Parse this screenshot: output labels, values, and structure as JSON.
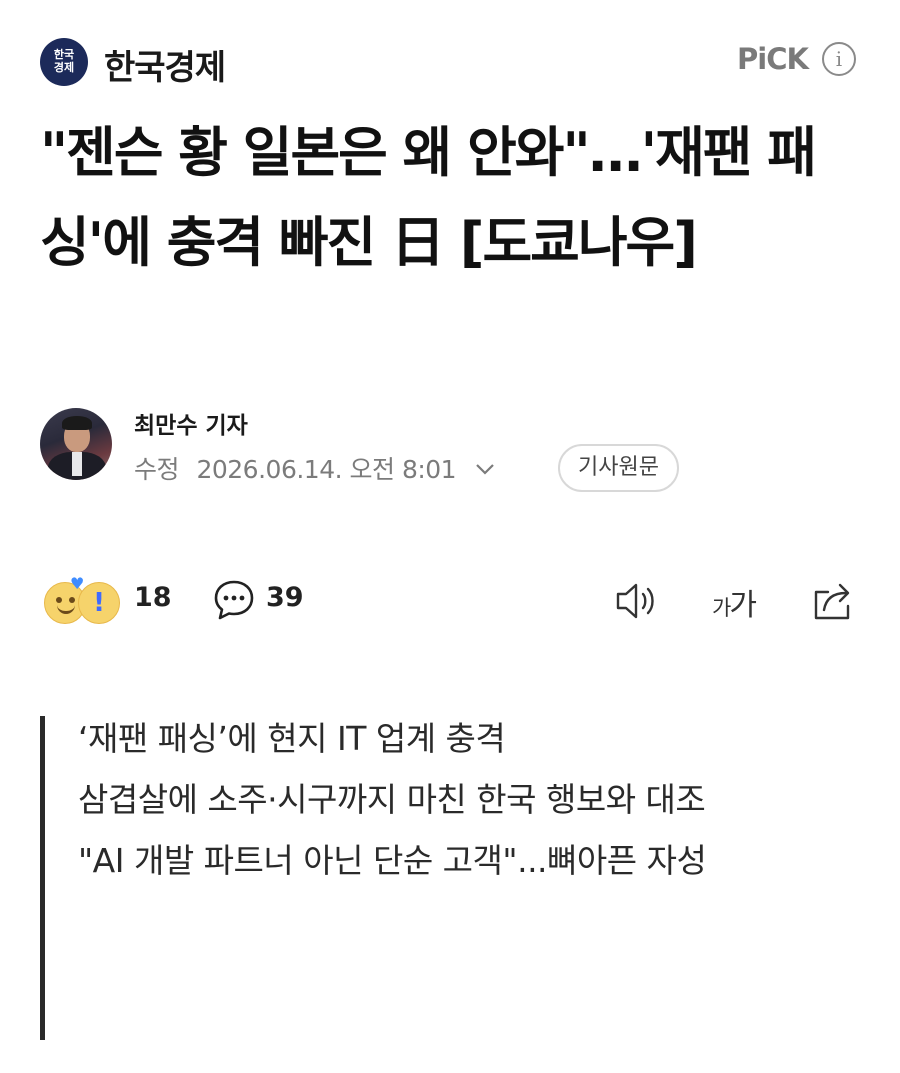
{
  "header": {
    "logo_text": "한국\n경제",
    "press_name": "한국경제",
    "pick_label": "PiCK",
    "info_icon": "info-icon"
  },
  "article": {
    "headline": "\"젠슨 황 일본은 왜 안와\"…'재팬 패싱'에 충격 빠진 日 [도쿄나우]",
    "reporter": "최만수 기자",
    "modified_label": "수정",
    "modified_at": "2026.06.14. 오전 8:01",
    "original_button": "기사원문"
  },
  "actions": {
    "reaction_count": "18",
    "comment_count": "39",
    "font_size_label_small": "가",
    "font_size_label_large": "가",
    "icons": [
      "reaction-emoji-icon",
      "comment-icon",
      "text-to-speech-icon",
      "font-size-icon",
      "share-icon"
    ]
  },
  "summary": [
    "‘재팬 패싱’에 현지 IT 업계 충격",
    "삼겹살에 소주·시구까지 마친 한국 행보와 대조",
    "\"AI 개발 파트너 아닌 단순 고객\"...뼈아픈 자성"
  ],
  "colors": {
    "logo_bg": "#1c2a5a",
    "muted_text": "#7b7b7b",
    "accent_blue": "#3f8cff"
  }
}
